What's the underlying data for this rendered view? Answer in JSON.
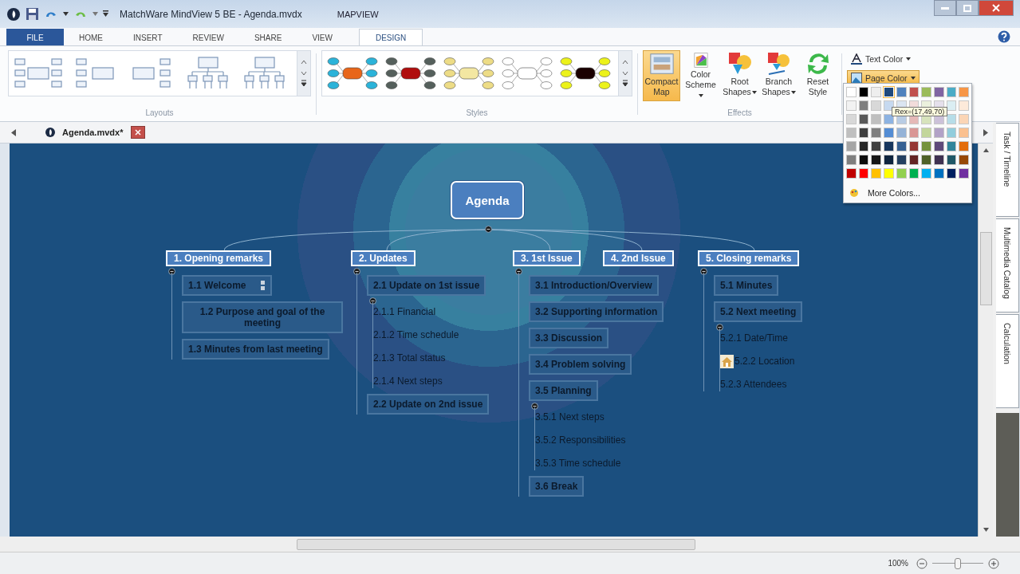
{
  "window": {
    "title": "MatchWare MindView 5 BE - Agenda.mvdx",
    "context_tab": "MAPVIEW"
  },
  "tabs": [
    {
      "label": "FILE",
      "kind": "file",
      "selected": false
    },
    {
      "label": "HOME",
      "kind": "tab",
      "selected": false
    },
    {
      "label": "INSERT",
      "kind": "tab",
      "selected": false
    },
    {
      "label": "REVIEW",
      "kind": "tab",
      "selected": false
    },
    {
      "label": "SHARE",
      "kind": "tab",
      "selected": false
    },
    {
      "label": "VIEW",
      "kind": "tab",
      "selected": false
    },
    {
      "label": "DESIGN",
      "kind": "tab",
      "selected": true
    }
  ],
  "layouts": {
    "label": "Layouts",
    "items": [
      {
        "kind": "map"
      },
      {
        "kind": "right"
      },
      {
        "kind": "left"
      },
      {
        "kind": "org"
      },
      {
        "kind": "org"
      }
    ]
  },
  "styles": {
    "label": "Styles",
    "items": [
      {
        "kind": "bubble"
      },
      {
        "kind": "block"
      },
      {
        "kind": "soft"
      },
      {
        "kind": "outline"
      },
      {
        "kind": "contrast"
      }
    ]
  },
  "effects": {
    "label": "Effects",
    "buttons": [
      {
        "label": "Compact Map",
        "kind": "compact",
        "dropdown": false,
        "selected": true
      },
      {
        "label": "Color Scheme",
        "kind": "scheme",
        "dropdown": true,
        "selected": false
      },
      {
        "label": "Root Shapes",
        "kind": "shapes",
        "dropdown": true,
        "selected": false
      },
      {
        "label": "Branch Shapes",
        "kind": "branch",
        "dropdown": true,
        "selected": false
      },
      {
        "label": "Reset Style",
        "kind": "reset",
        "dropdown": false,
        "selected": false
      }
    ]
  },
  "color_buttons": [
    {
      "label": "Text Color",
      "kind": "text",
      "open": false
    },
    {
      "label": "Page Color",
      "kind": "page",
      "open": true
    }
  ],
  "palette": {
    "tooltip": "Rex=(17,49,70)",
    "more": "More Colors...",
    "rows": [
      {
        "swatches": [
          {
            "color": "#ffffff",
            "selected": false
          },
          {
            "color": "#000000",
            "selected": false
          },
          {
            "color": "#eeeeee",
            "selected": false
          },
          {
            "color": "#1f497d",
            "selected": true
          },
          {
            "color": "#4f81bd",
            "selected": false
          },
          {
            "color": "#c0504d",
            "selected": false
          },
          {
            "color": "#9bbb59",
            "selected": false
          },
          {
            "color": "#8064a2",
            "selected": false
          },
          {
            "color": "#4bacc6",
            "selected": false
          },
          {
            "color": "#f79646",
            "selected": false
          }
        ]
      },
      {
        "swatches": [
          {
            "color": "#f2f2f2",
            "selected": false
          },
          {
            "color": "#7f7f7f",
            "selected": false
          },
          {
            "color": "#d8d8d8",
            "selected": false
          },
          {
            "color": "#c6d9f0",
            "selected": false
          },
          {
            "color": "#dbe5f1",
            "selected": false
          },
          {
            "color": "#f2dcdb",
            "selected": false
          },
          {
            "color": "#ebf1dd",
            "selected": false
          },
          {
            "color": "#e5e0ec",
            "selected": false
          },
          {
            "color": "#dbeef3",
            "selected": false
          },
          {
            "color": "#fdeada",
            "selected": false
          }
        ]
      },
      {
        "swatches": [
          {
            "color": "#d8d8d8",
            "selected": false
          },
          {
            "color": "#595959",
            "selected": false
          },
          {
            "color": "#bfbfbf",
            "selected": false
          },
          {
            "color": "#8db3e2",
            "selected": false
          },
          {
            "color": "#b8cce4",
            "selected": false
          },
          {
            "color": "#e5b9b7",
            "selected": false
          },
          {
            "color": "#d7e3bc",
            "selected": false
          },
          {
            "color": "#ccc1d9",
            "selected": false
          },
          {
            "color": "#b7dde8",
            "selected": false
          },
          {
            "color": "#fbd5b5",
            "selected": false
          }
        ]
      },
      {
        "swatches": [
          {
            "color": "#bfbfbf",
            "selected": false
          },
          {
            "color": "#3f3f3f",
            "selected": false
          },
          {
            "color": "#7f7f7f",
            "selected": false
          },
          {
            "color": "#548dd4",
            "selected": false
          },
          {
            "color": "#95b3d7",
            "selected": false
          },
          {
            "color": "#d99694",
            "selected": false
          },
          {
            "color": "#c3d69b",
            "selected": false
          },
          {
            "color": "#b2a2c7",
            "selected": false
          },
          {
            "color": "#92cddc",
            "selected": false
          },
          {
            "color": "#fac08f",
            "selected": false
          }
        ]
      },
      {
        "swatches": [
          {
            "color": "#a5a5a5",
            "selected": false
          },
          {
            "color": "#262626",
            "selected": false
          },
          {
            "color": "#3f3f3f",
            "selected": false
          },
          {
            "color": "#17365d",
            "selected": false
          },
          {
            "color": "#366092",
            "selected": false
          },
          {
            "color": "#953734",
            "selected": false
          },
          {
            "color": "#76923c",
            "selected": false
          },
          {
            "color": "#5f497a",
            "selected": false
          },
          {
            "color": "#31859b",
            "selected": false
          },
          {
            "color": "#e36c09",
            "selected": false
          }
        ]
      },
      {
        "swatches": [
          {
            "color": "#7f7f7f",
            "selected": false
          },
          {
            "color": "#0c0c0c",
            "selected": false
          },
          {
            "color": "#161616",
            "selected": false
          },
          {
            "color": "#0f243e",
            "selected": false
          },
          {
            "color": "#244061",
            "selected": false
          },
          {
            "color": "#632423",
            "selected": false
          },
          {
            "color": "#4f6128",
            "selected": false
          },
          {
            "color": "#3f3151",
            "selected": false
          },
          {
            "color": "#205867",
            "selected": false
          },
          {
            "color": "#974806",
            "selected": false
          }
        ]
      },
      {
        "swatches": [
          {
            "color": "#c00000",
            "selected": false
          },
          {
            "color": "#ff0000",
            "selected": false
          },
          {
            "color": "#ffc000",
            "selected": false
          },
          {
            "color": "#ffff00",
            "selected": false
          },
          {
            "color": "#92d050",
            "selected": false
          },
          {
            "color": "#00b050",
            "selected": false
          },
          {
            "color": "#00b0f0",
            "selected": false
          },
          {
            "color": "#0070c0",
            "selected": false
          },
          {
            "color": "#002060",
            "selected": false
          },
          {
            "color": "#7030a0",
            "selected": false
          }
        ]
      }
    ]
  },
  "document_tab": {
    "label": "Agenda.mvdx*"
  },
  "map": {
    "root": "Agenda",
    "branches": [
      {
        "label": "1.  Opening remarks",
        "children": [
          {
            "kind": "sub",
            "label": "1.1  Welcome",
            "note": true
          },
          {
            "kind": "sub",
            "label": "1.2   Purpose and goal of the meeting"
          },
          {
            "kind": "sub",
            "label": "1.3  Minutes from last meeting"
          }
        ]
      },
      {
        "label": "2.  Updates",
        "children": [
          {
            "kind": "sub",
            "label": "2.1  Update on 1st issue",
            "children": [
              {
                "kind": "leaf",
                "label": "2.1.1  Financial"
              },
              {
                "kind": "leaf",
                "label": "2.1.2  Time schedule"
              },
              {
                "kind": "leaf",
                "label": "2.1.3  Total status"
              },
              {
                "kind": "leaf",
                "label": "2.1.4  Next steps"
              }
            ]
          },
          {
            "kind": "sub",
            "label": "2.2  Update on 2nd issue"
          }
        ]
      },
      {
        "label": "3.  1st Issue",
        "children": [
          {
            "kind": "sub",
            "label": "3.1  Introduction/Overview"
          },
          {
            "kind": "sub",
            "label": "3.2  Supporting information"
          },
          {
            "kind": "sub",
            "label": "3.3  Discussion"
          },
          {
            "kind": "sub",
            "label": "3.4  Problem solving"
          },
          {
            "kind": "sub",
            "label": "3.5  Planning",
            "children": [
              {
                "kind": "leaf",
                "label": "3.5.1  Next steps"
              },
              {
                "kind": "leaf",
                "label": "3.5.2  Responsibilities"
              },
              {
                "kind": "leaf",
                "label": "3.5.3  Time schedule"
              }
            ]
          },
          {
            "kind": "sub",
            "label": "3.6  Break"
          }
        ]
      },
      {
        "label": "4.  2nd Issue"
      },
      {
        "label": "5.  Closing remarks",
        "children": [
          {
            "kind": "sub",
            "label": "5.1  Minutes"
          },
          {
            "kind": "sub",
            "label": "5.2  Next meeting",
            "children": [
              {
                "kind": "leaf",
                "label": "5.2.1  Date/Time"
              },
              {
                "kind": "leaf",
                "label": "5.2.2  Location",
                "picture_icon": true
              },
              {
                "kind": "leaf",
                "label": "5.2.3  Attendees"
              }
            ]
          }
        ]
      }
    ]
  },
  "side_tabs": [
    "Task / Timeline",
    "Multimedia Catalog",
    "Calculation"
  ],
  "status_bar": {
    "zoom": "100%",
    "zoom_slider": {
      "level": 0.5
    }
  }
}
